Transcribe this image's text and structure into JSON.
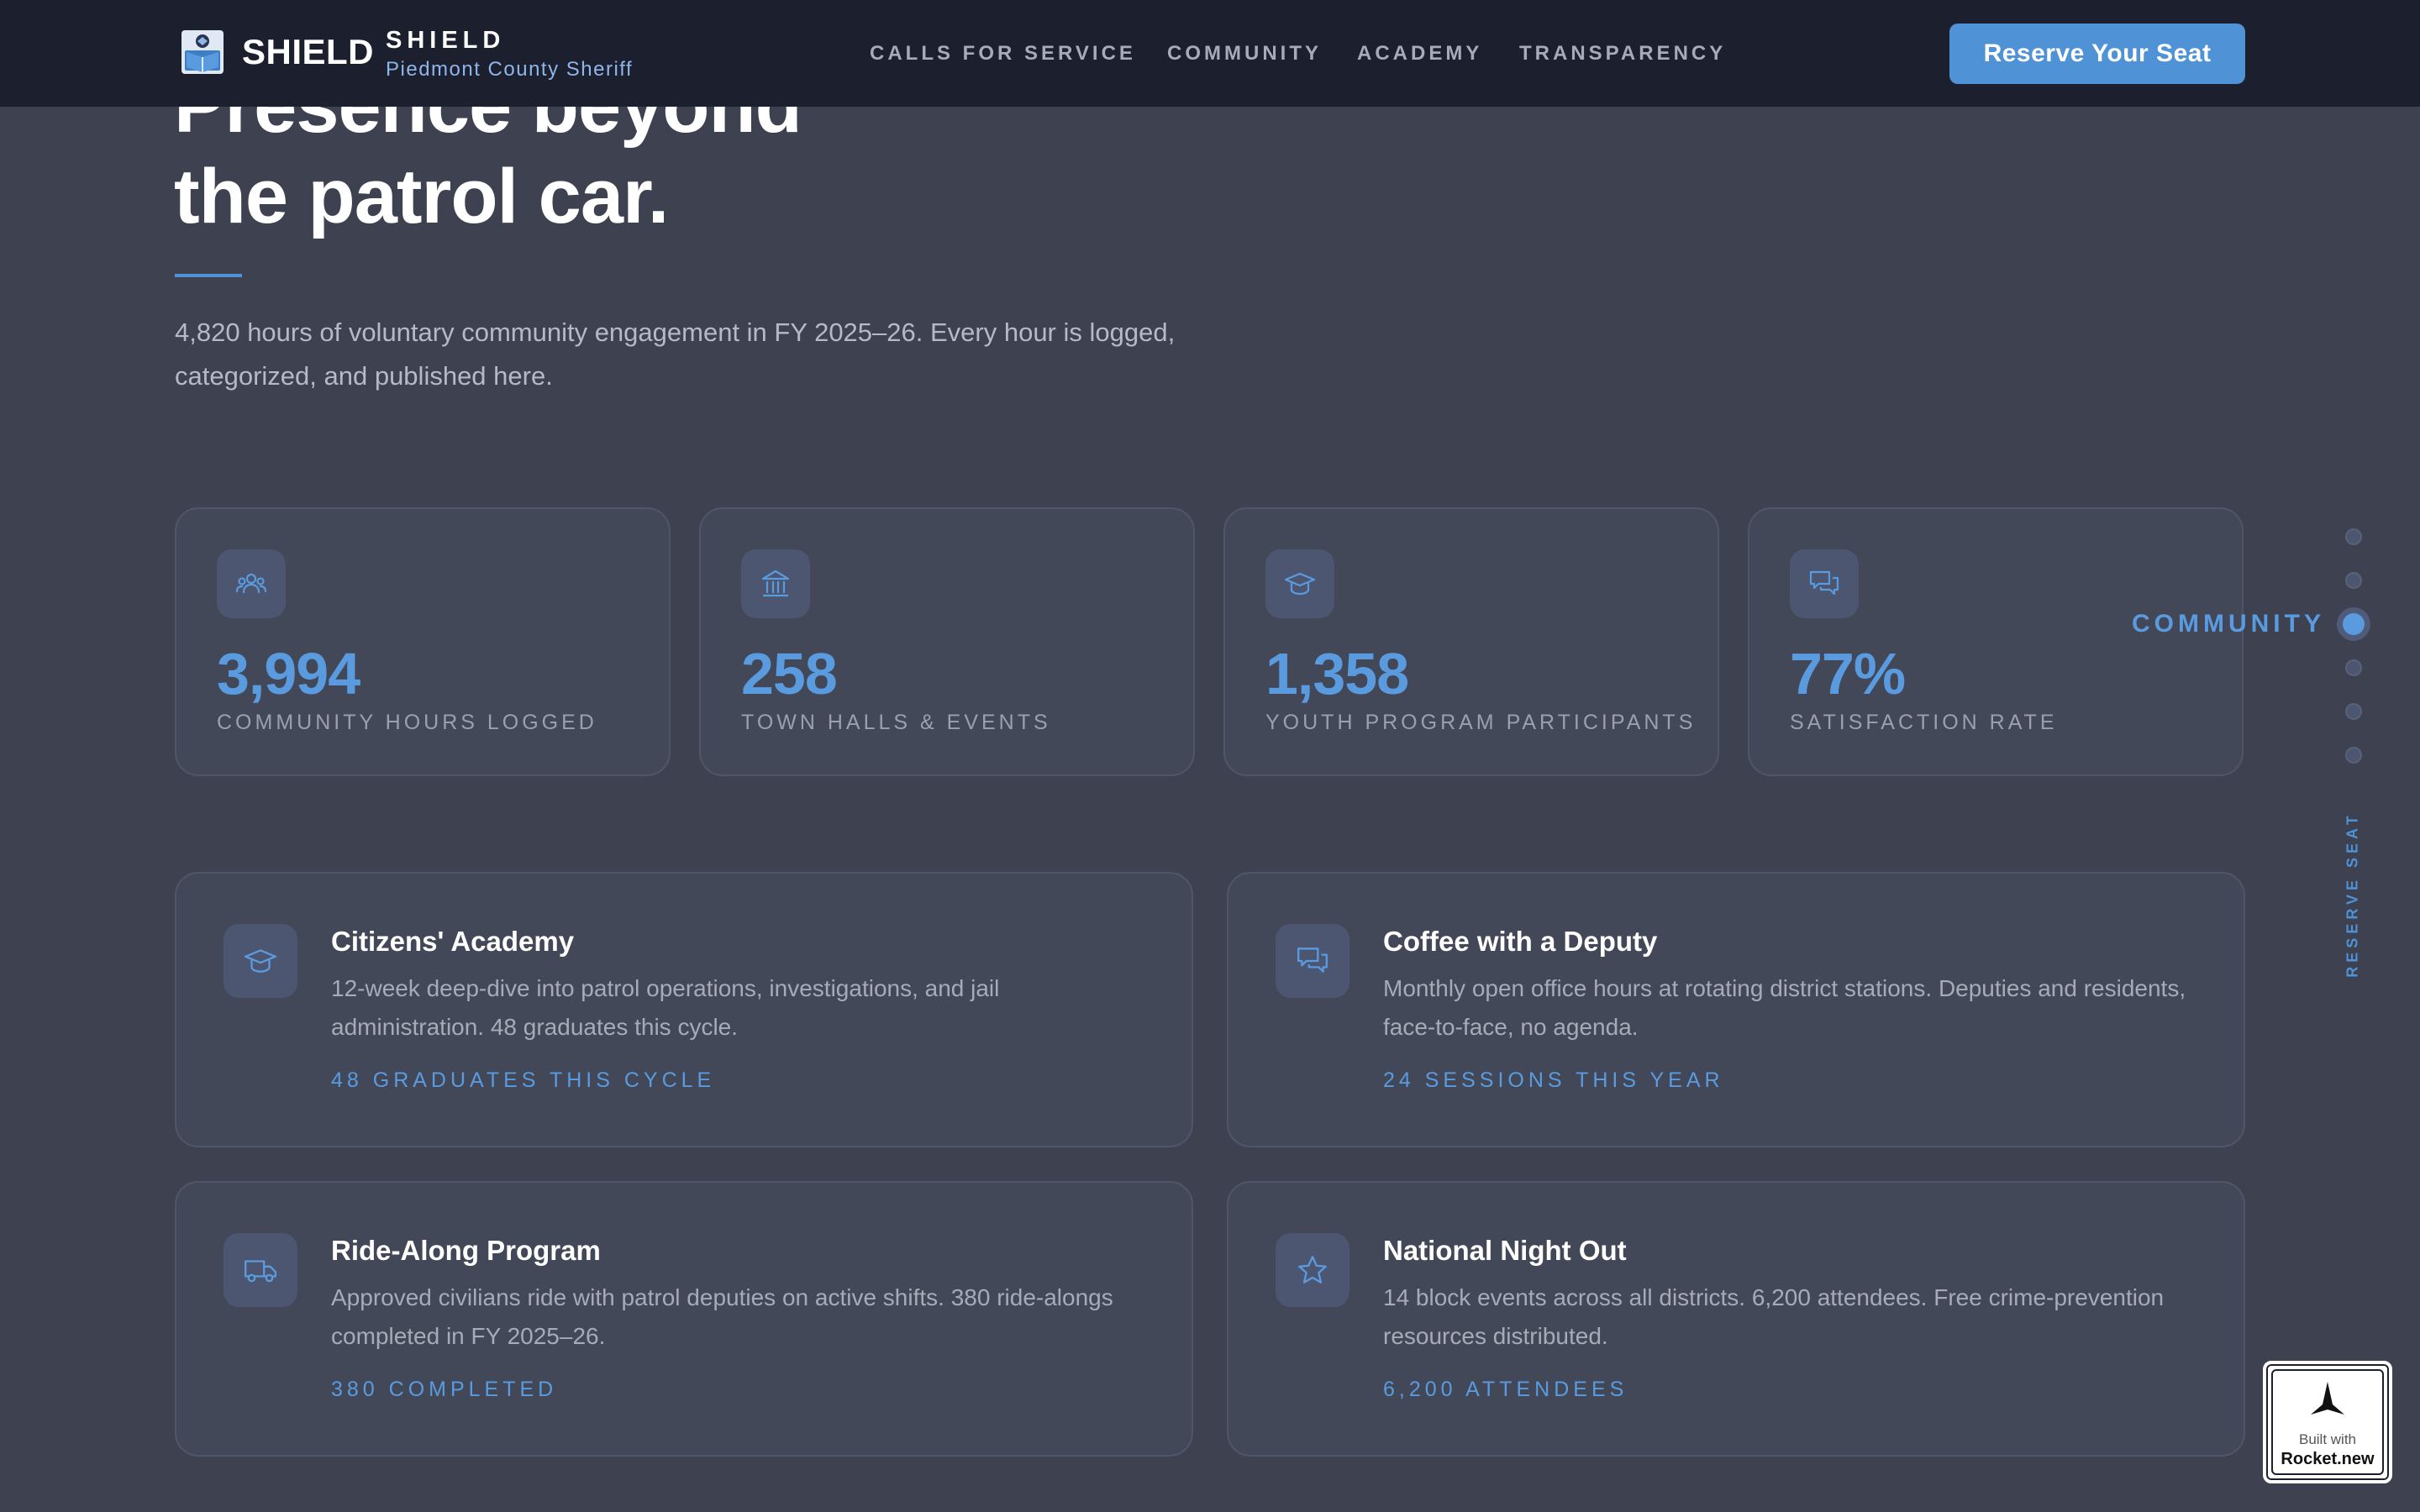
{
  "header": {
    "logo_icon": "shield-book-icon",
    "brand_word": "SHIELD",
    "brand_title": "SHIELD",
    "brand_subtitle": "Piedmont County Sheriff",
    "nav": [
      "CALLS FOR SERVICE",
      "COMMUNITY",
      "ACADEMY",
      "TRANSPARENCY"
    ],
    "cta_label": "Reserve Your Seat"
  },
  "hero": {
    "line1": "Presence beyond",
    "line2": "the patrol car.",
    "description": "4,820 hours of voluntary community engagement in FY 2025–26. Every hour is logged, categorized, and published here."
  },
  "stats": [
    {
      "icon": "people-icon",
      "value": "3,994",
      "label": "COMMUNITY HOURS LOGGED"
    },
    {
      "icon": "building-icon",
      "value": "258",
      "label": "TOWN HALLS & EVENTS"
    },
    {
      "icon": "graduation-cap-icon",
      "value": "1,358",
      "label": "YOUTH PROGRAM PARTICIPANTS"
    },
    {
      "icon": "chat-icon",
      "value": "77%",
      "label": "SATISFACTION RATE"
    }
  ],
  "programs": [
    {
      "icon": "graduation-cap-icon",
      "title": "Citizens' Academy",
      "description": "12-week deep-dive into patrol operations, investigations, and jail administration. 48 graduates this cycle.",
      "meta": "48 GRADUATES THIS CYCLE"
    },
    {
      "icon": "chat-icon",
      "title": "Coffee with a Deputy",
      "description": "Monthly open office hours at rotating district stations. Deputies and residents, face-to-face, no agenda.",
      "meta": "24 SESSIONS THIS YEAR"
    },
    {
      "icon": "truck-icon",
      "title": "Ride-Along Program",
      "description": "Approved civilians ride with patrol deputies on active shifts. 380 ride-alongs completed in FY 2025–26.",
      "meta": "380 COMPLETED"
    },
    {
      "icon": "star-icon",
      "title": "National Night Out",
      "description": "14 block events across all districts. 6,200 attendees. Free crime-prevention resources distributed.",
      "meta": "6,200 ATTENDEES"
    }
  ],
  "side_nav": {
    "active_label": "COMMUNITY",
    "reserve_label": "RESERVE SEAT"
  },
  "badge": {
    "line1": "Built with",
    "line2": "Rocket.new"
  },
  "colors": {
    "page_bg": "#3d4150",
    "header_bg": "#1c1f2e",
    "accent": "#4f92d6",
    "card_bg": "#434858"
  }
}
